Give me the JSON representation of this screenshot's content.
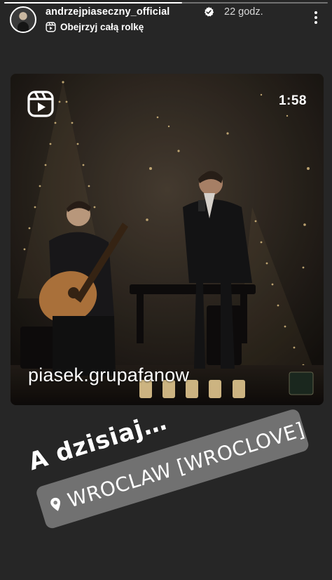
{
  "story": {
    "progress": 0.55
  },
  "header": {
    "username": "andrzejpiaseczny_official",
    "time": "22 godz.",
    "reel_link": "Obejrzyj całą rolkę"
  },
  "video": {
    "duration": "1:58",
    "watermark": "piasek.grupafanow"
  },
  "stickers": {
    "text": "A dzisiaj…",
    "location": "WROCLAW [WROCLOVE]"
  },
  "colors": {
    "background": "#262626",
    "verified": "#ffffff"
  },
  "icons": [
    "reels-icon",
    "verified-icon",
    "more-options-icon",
    "location-pin-icon"
  ]
}
